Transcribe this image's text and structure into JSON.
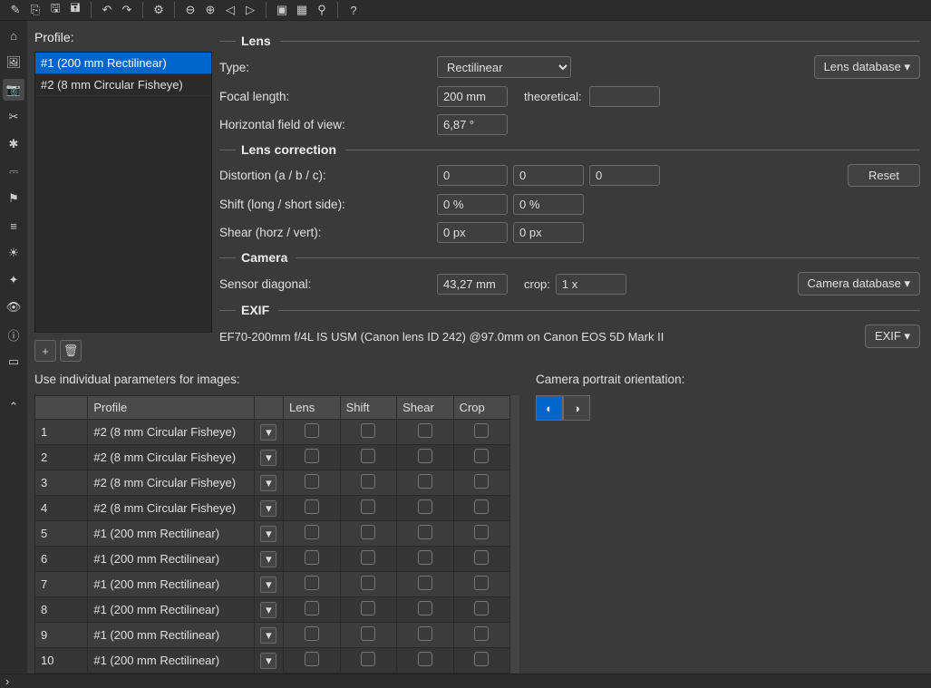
{
  "toolbar_icons": [
    "new",
    "open",
    "save",
    "save-as",
    "undo",
    "redo",
    "settings",
    "zoom-out",
    "zoom-in",
    "prev",
    "next",
    "panels",
    "grid",
    "pin",
    "help"
  ],
  "left_icons": [
    "home",
    "image",
    "camera",
    "crop",
    "adjust",
    "equalizer",
    "geotag",
    "stack",
    "brightness",
    "deghost",
    "preview",
    "info",
    "layout",
    "collapse"
  ],
  "profile": {
    "label": "Profile:",
    "items": [
      {
        "label": "#1 (200 mm Rectilinear)",
        "selected": true
      },
      {
        "label": "#2 (8 mm Circular Fisheye)",
        "selected": false
      }
    ],
    "add": "+",
    "del": "🗑"
  },
  "form": {
    "lens": {
      "title": "Lens",
      "type": {
        "label": "Type:",
        "value": "Rectilinear",
        "button": "Lens database ▾"
      },
      "focal": {
        "label": "Focal length:",
        "value": "200 mm",
        "theoretical_label": "theoretical:",
        "theoretical_value": ""
      },
      "hfov": {
        "label": "Horizontal field of view:",
        "value": "6,87 °"
      }
    },
    "corr": {
      "title": "Lens correction",
      "dist": {
        "label": "Distortion (a / b / c):",
        "a": "0",
        "b": "0",
        "c": "0",
        "reset": "Reset"
      },
      "shift": {
        "label": "Shift (long / short side):",
        "a": "0 %",
        "b": "0 %"
      },
      "shear": {
        "label": "Shear (horz / vert):",
        "a": "0 px",
        "b": "0 px"
      }
    },
    "cam": {
      "title": "Camera",
      "sensor": {
        "label": "Sensor diagonal:",
        "value": "43,27 mm",
        "crop_label": "crop:",
        "crop_value": "1 x",
        "button": "Camera database ▾"
      }
    },
    "exif": {
      "title": "EXIF",
      "text": "EF70-200mm f/4L IS USM (Canon lens ID 242) @97.0mm on Canon EOS 5D Mark II",
      "button": "EXIF ▾"
    }
  },
  "images": {
    "label": "Use individual parameters for images:",
    "orient_label": "Camera portrait orientation:",
    "headers": {
      "idx": "",
      "profile": "Profile",
      "dd": "",
      "lens": "Lens",
      "shift": "Shift",
      "shear": "Shear",
      "crop": "Crop"
    },
    "rows": [
      {
        "n": "1",
        "p": "#2 (8 mm Circular Fisheye)"
      },
      {
        "n": "2",
        "p": "#2 (8 mm Circular Fisheye)"
      },
      {
        "n": "3",
        "p": "#2 (8 mm Circular Fisheye)"
      },
      {
        "n": "4",
        "p": "#2 (8 mm Circular Fisheye)"
      },
      {
        "n": "5",
        "p": "#1 (200 mm Rectilinear)"
      },
      {
        "n": "6",
        "p": "#1 (200 mm Rectilinear)"
      },
      {
        "n": "7",
        "p": "#1 (200 mm Rectilinear)"
      },
      {
        "n": "8",
        "p": "#1 (200 mm Rectilinear)"
      },
      {
        "n": "9",
        "p": "#1 (200 mm Rectilinear)"
      },
      {
        "n": "10",
        "p": "#1 (200 mm Rectilinear)"
      }
    ]
  }
}
